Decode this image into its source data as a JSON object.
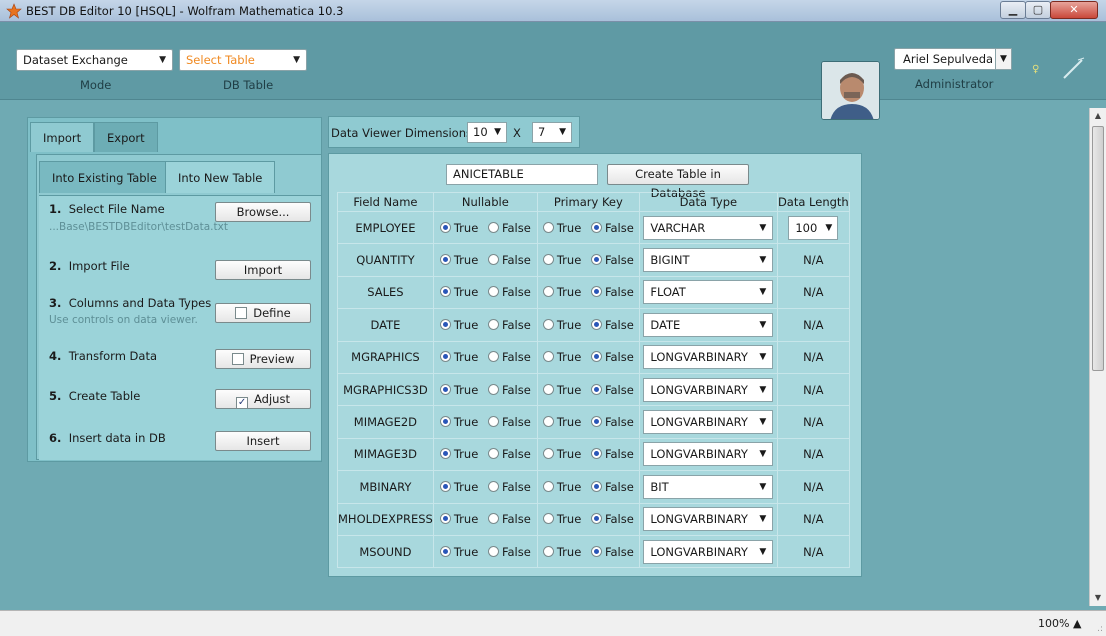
{
  "window": {
    "title": "BEST DB Editor 10 [HSQL] - Wolfram Mathematica 10.3",
    "minimize": "▁",
    "maximize": "▢",
    "close": "✕"
  },
  "header": {
    "mode_value": "Dataset Exchange",
    "mode_caption": "Mode",
    "table_value": "Select Table",
    "table_caption": "DB Table",
    "user_name": "Ariel Sepulveda",
    "user_role": "Administrator",
    "accent_color": "#f08a22"
  },
  "left_panel": {
    "tabs": [
      "Import",
      "Export"
    ],
    "sub_tabs": [
      "Into Existing Table",
      "Into New Table"
    ],
    "steps": [
      {
        "num": "1.",
        "label": "Select File Name",
        "sub": "...Base\\BESTDBEditor\\testData.txt",
        "button": "Browse...",
        "checkbox": false
      },
      {
        "num": "2.",
        "label": "Import File",
        "button": "Import",
        "checkbox": false
      },
      {
        "num": "3.",
        "label": "Columns and Data Types",
        "sub": "Use controls on data viewer.",
        "button": "Define",
        "checkbox": true,
        "checked": false
      },
      {
        "num": "4.",
        "label": "Transform Data",
        "button": "Preview",
        "checkbox": true,
        "checked": false
      },
      {
        "num": "5.",
        "label": "Create Table",
        "button": "Adjust",
        "checkbox": true,
        "checked": true
      },
      {
        "num": "6.",
        "label": "Insert data in DB",
        "button": "Insert",
        "checkbox": false
      }
    ]
  },
  "viewer": {
    "dimensions_label": "Data Viewer Dimensions",
    "rows": "10",
    "x": "X",
    "cols": "7"
  },
  "grid": {
    "table_name": "ANICETABLE",
    "create_button": "Create Table in Database",
    "headers": [
      "Field Name",
      "Nullable",
      "Primary Key",
      "Data Type",
      "Data Length"
    ],
    "true_label": "True",
    "false_label": "False",
    "rows": [
      {
        "field": "EMPLOYEE",
        "nullable": true,
        "pk": false,
        "type": "VARCHAR",
        "length": "100",
        "length_is_combo": true
      },
      {
        "field": "QUANTITY",
        "nullable": true,
        "pk": false,
        "type": "BIGINT",
        "length": "N/A"
      },
      {
        "field": "SALES",
        "nullable": true,
        "pk": false,
        "type": "FLOAT",
        "length": "N/A"
      },
      {
        "field": "DATE",
        "nullable": true,
        "pk": false,
        "type": "DATE",
        "length": "N/A"
      },
      {
        "field": "MGRAPHICS",
        "nullable": true,
        "pk": false,
        "type": "LONGVARBINARY",
        "length": "N/A"
      },
      {
        "field": "MGRAPHICS3D",
        "nullable": true,
        "pk": false,
        "type": "LONGVARBINARY",
        "length": "N/A"
      },
      {
        "field": "MIMAGE2D",
        "nullable": true,
        "pk": false,
        "type": "LONGVARBINARY",
        "length": "N/A"
      },
      {
        "field": "MIMAGE3D",
        "nullable": true,
        "pk": false,
        "type": "LONGVARBINARY",
        "length": "N/A"
      },
      {
        "field": "MBINARY",
        "nullable": true,
        "pk": false,
        "type": "BIT",
        "length": "N/A"
      },
      {
        "field": "MHOLDEXPRESS",
        "nullable": true,
        "pk": false,
        "type": "LONGVARBINARY",
        "length": "N/A"
      },
      {
        "field": "MSOUND",
        "nullable": true,
        "pk": false,
        "type": "LONGVARBINARY",
        "length": "N/A"
      }
    ]
  },
  "status": {
    "zoom": "100%",
    "zoom_arrow": "▲"
  },
  "icons": {
    "dropdown": "▼",
    "check": "✓",
    "bulb": "♀",
    "scroll_up": "▲",
    "scroll_down": "▼",
    "grip": ".:"
  }
}
